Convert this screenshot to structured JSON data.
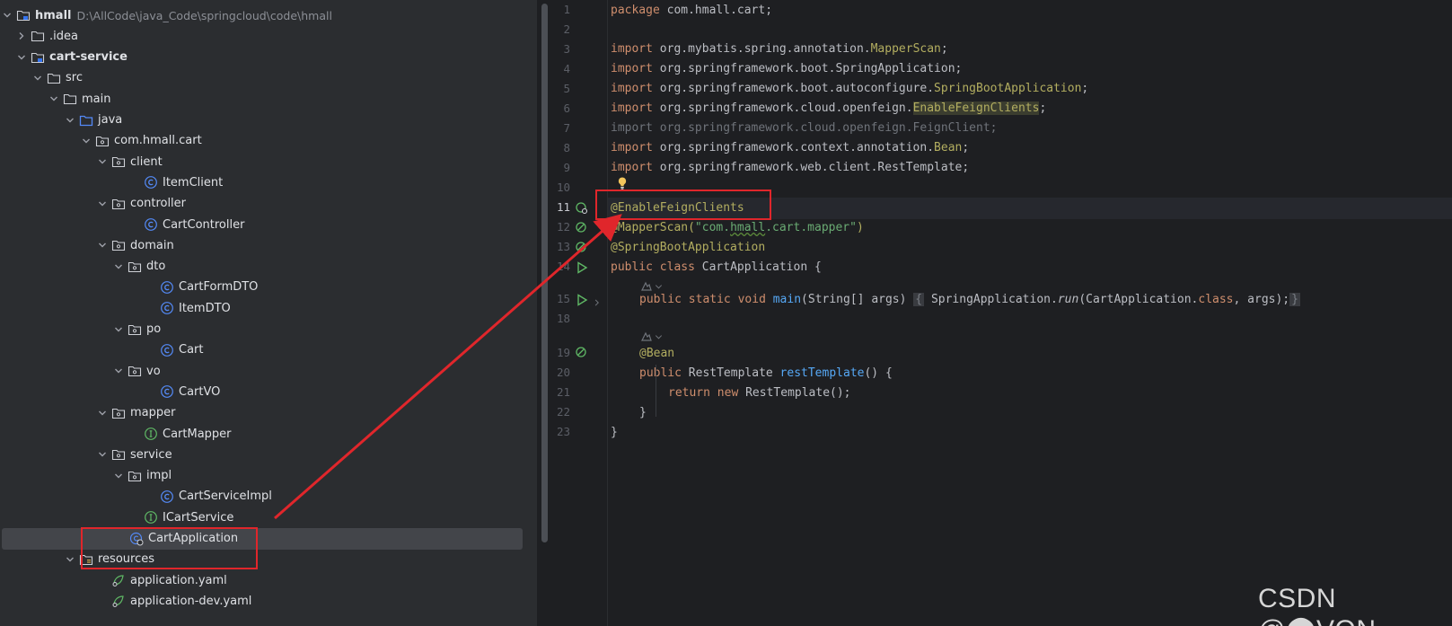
{
  "project_tree": {
    "items": [
      {
        "label": "hmall",
        "hint": "D:\\AllCode\\java_Code\\springcloud\\code\\hmall",
        "bold": true
      },
      {
        "label": ".idea"
      },
      {
        "label": "cart-service",
        "bold": true
      },
      {
        "label": "src"
      },
      {
        "label": "main"
      },
      {
        "label": "java"
      },
      {
        "label": "com.hmall.cart"
      },
      {
        "label": "client"
      },
      {
        "label": "ItemClient"
      },
      {
        "label": "controller"
      },
      {
        "label": "CartController"
      },
      {
        "label": "domain"
      },
      {
        "label": "dto"
      },
      {
        "label": "CartFormDTO"
      },
      {
        "label": "ItemDTO"
      },
      {
        "label": "po"
      },
      {
        "label": "Cart"
      },
      {
        "label": "vo"
      },
      {
        "label": "CartVO"
      },
      {
        "label": "mapper"
      },
      {
        "label": "CartMapper"
      },
      {
        "label": "service"
      },
      {
        "label": "impl"
      },
      {
        "label": "CartServiceImpl"
      },
      {
        "label": "ICartService"
      },
      {
        "label": "CartApplication"
      },
      {
        "label": "resources"
      },
      {
        "label": "application.yaml"
      },
      {
        "label": "application-dev.yaml"
      }
    ]
  },
  "editor": {
    "line_numbers": [
      "1",
      "2",
      "3",
      "4",
      "5",
      "6",
      "7",
      "8",
      "9",
      "10",
      "11",
      "12",
      "13",
      "14",
      "15",
      "18",
      "19",
      "20",
      "21",
      "22",
      "23"
    ],
    "tokens": {
      "package": "package",
      "import": "import",
      "public": "public",
      "class": "class",
      "static": "static",
      "void": "void",
      "return": "return",
      "new": "new"
    },
    "lines": {
      "l1": "com.hmall.cart;",
      "l3a": "org.mybatis.spring.annotation.",
      "l3b": "MapperScan",
      "l4": "org.springframework.boot.SpringApplication;",
      "l5a": "org.springframework.boot.autoconfigure.",
      "l5b": "SpringBootApplication",
      "l6a": "org.springframework.cloud.openfeign.",
      "l6b": "EnableFeignClients",
      "l7": "import org.springframework.cloud.openfeign.FeignClient;",
      "l8a": "org.springframework.context.annotation.",
      "l8b": "Bean",
      "l9": "org.springframework.web.client.RestTemplate;",
      "l11": "@EnableFeignClients",
      "l12a": "@MapperScan(",
      "l12b": "\"com.",
      "l12c": "hmall",
      "l12d": ".cart.mapper\"",
      "l13": "@SpringBootApplication",
      "l14": "CartApplication {",
      "l15a": "main",
      "l15b": "(String[] args)",
      "l15c": "{",
      "l15d": "SpringApplication.",
      "l15e": "run",
      "l15f": "(CartApplication.",
      "l15g": ", args);",
      "l15h": "}",
      "l19": "@Bean",
      "l20a": "RestTemplate",
      "l20b": "restTemplate",
      "l20c": "() {",
      "l21": "RestTemplate();",
      "l22": "}",
      "l23": "}",
      "semicolon": ";",
      "close_paren": ")"
    }
  },
  "watermark": "CSDN @⬤VON",
  "colors": {
    "annotation_red": "#e0262b",
    "keyword": "#cf8e6d",
    "annotation": "#b3ae60",
    "string": "#6aab73",
    "function": "#56a8f5"
  }
}
